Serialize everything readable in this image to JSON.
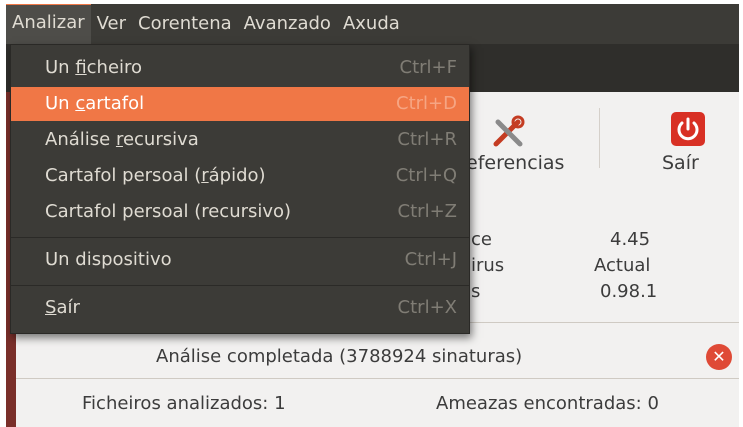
{
  "menubar": {
    "items": [
      "Analizar",
      "Ver",
      "Corentena",
      "Avanzado",
      "Axuda"
    ]
  },
  "menu": {
    "items": [
      {
        "pre": "Un ",
        "mn": "f",
        "post": "icheiro",
        "accel": "Ctrl+F"
      },
      {
        "pre": "Un ",
        "mn": "c",
        "post": "artafol",
        "accel": "Ctrl+D"
      },
      {
        "pre": "Análise ",
        "mn": "r",
        "post": "ecursiva",
        "accel": "Ctrl+R"
      },
      {
        "pre": "Cartafol persoal (",
        "mn": "r",
        "post": "ápido)",
        "accel": "Ctrl+Q"
      },
      {
        "pre": "Cartafol persoal (recursivo)",
        "mn": "",
        "post": "",
        "accel": "Ctrl+Z"
      },
      {
        "pre": "Un dispositivo",
        "mn": "",
        "post": "",
        "accel": "Ctrl+J"
      },
      {
        "pre": "",
        "mn": "S",
        "post": "aír",
        "accel": "Ctrl+X"
      }
    ]
  },
  "toolbar": {
    "preferences_label": "eferencias",
    "quit_label": "Saír"
  },
  "info": {
    "labels": [
      "ce",
      "irus",
      "s"
    ],
    "values": [
      "4.45",
      "Actual",
      "0.98.1"
    ]
  },
  "status": {
    "message": "Análise completada (3788924 sinaturas)",
    "files_scanned": "Ficheiros analizados: 1",
    "threats_found": "Ameazas encontradas: 0"
  },
  "colors": {
    "highlight": "#f07746",
    "menu_bg": "#3c3b37",
    "content_bg": "#f2f1f0",
    "quit_icon": "#d83024"
  }
}
